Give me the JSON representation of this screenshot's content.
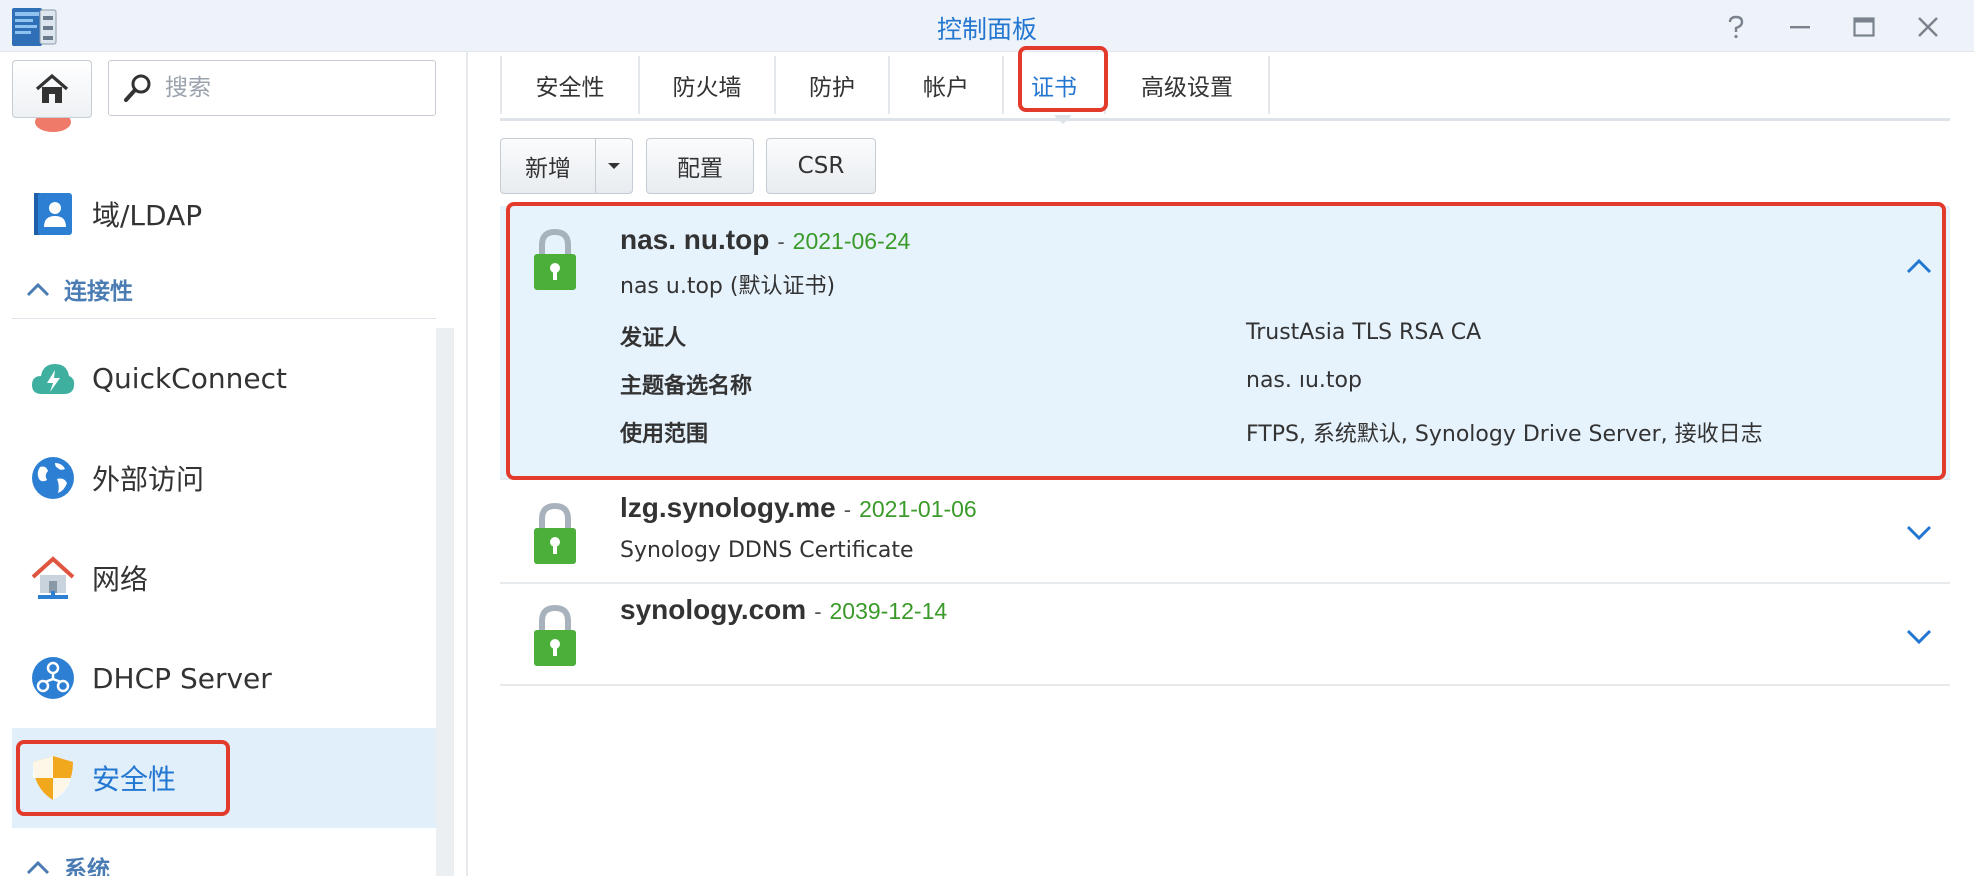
{
  "window": {
    "title": "控制面板",
    "help_icon": "question-icon",
    "minimize_icon": "minimize-icon",
    "maximize_icon": "maximize-icon",
    "close_icon": "close-icon"
  },
  "sidebar": {
    "search_placeholder": "搜索",
    "items": [
      {
        "label": "域/LDAP",
        "icon": "domain-ldap-icon"
      },
      {
        "label": "QuickConnect",
        "icon": "quickconnect-icon"
      },
      {
        "label": "外部访问",
        "icon": "globe-icon"
      },
      {
        "label": "网络",
        "icon": "network-house-icon"
      },
      {
        "label": "DHCP Server",
        "icon": "dhcp-icon"
      },
      {
        "label": "安全性",
        "icon": "shield-icon",
        "active": true
      }
    ],
    "sections": {
      "connectivity": "连接性",
      "system": "系统"
    }
  },
  "tabs": [
    {
      "label": "安全性"
    },
    {
      "label": "防火墙"
    },
    {
      "label": "防护"
    },
    {
      "label": "帐户"
    },
    {
      "label": "证书",
      "active": true
    },
    {
      "label": "高级设置"
    }
  ],
  "toolbar": {
    "add_label": "新增",
    "configure_label": "配置",
    "csr_label": "CSR"
  },
  "certificates": [
    {
      "name": "nas.     nu.top",
      "separator": "-",
      "date": "2021-06-24",
      "subtitle": "nas      u.top (默认证书)",
      "expanded": true,
      "details": {
        "issuer_label": "发证人",
        "issuer_value": "TrustAsia TLS RSA CA",
        "san_label": "主题备选名称",
        "san_value": "nas.      ıu.top",
        "usage_label": "使用范围",
        "usage_value": "FTPS, 系统默认, Synology Drive Server, 接收日志"
      }
    },
    {
      "name": "lzg.synology.me",
      "separator": "-",
      "date": "2021-01-06",
      "subtitle": "Synology DDNS Certificate",
      "expanded": false
    },
    {
      "name": "synology.com",
      "separator": "-",
      "date": "2039-12-14",
      "subtitle": "",
      "expanded": false
    }
  ],
  "colors": {
    "accent": "#2477d1",
    "date_green": "#3a9a2a",
    "lock_green": "#4caf3a",
    "highlight_red": "#e23b2c",
    "selected_bg": "#e6f2fc"
  }
}
